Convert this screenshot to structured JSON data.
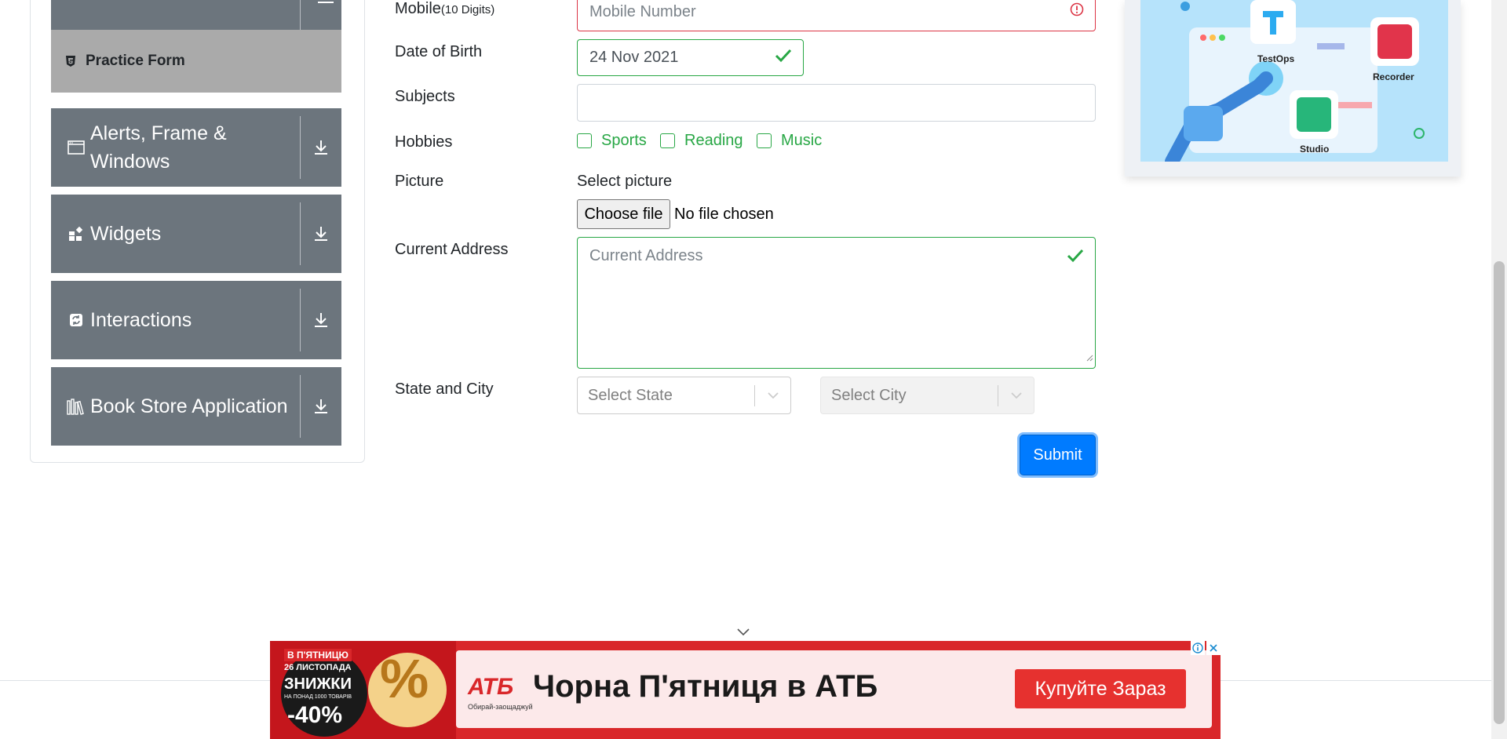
{
  "sidebar": {
    "active_item": {
      "label": "Practice Form",
      "icon": "html5-icon"
    },
    "groups": [
      {
        "label": "Alerts, Frame & Windows",
        "icon": "window-icon"
      },
      {
        "label": "Widgets",
        "icon": "widgets-icon"
      },
      {
        "label": "Interactions",
        "icon": "interactions-icon"
      },
      {
        "label": "Book Store Application",
        "icon": "books-icon"
      }
    ]
  },
  "form": {
    "mobile": {
      "label": "Mobile",
      "label_hint": "(10 Digits)",
      "placeholder": "Mobile Number",
      "status": "invalid"
    },
    "dob": {
      "label": "Date of Birth",
      "value": "24 Nov 2021",
      "status": "valid"
    },
    "subjects": {
      "label": "Subjects",
      "value": ""
    },
    "hobbies": {
      "label": "Hobbies",
      "options": [
        {
          "label": "Sports",
          "checked": false
        },
        {
          "label": "Reading",
          "checked": false
        },
        {
          "label": "Music",
          "checked": false
        }
      ]
    },
    "picture": {
      "label": "Picture",
      "select_label": "Select picture",
      "button_label": "Choose file",
      "file_text": "No file chosen"
    },
    "address": {
      "label": "Current Address",
      "placeholder": "Current Address",
      "status": "valid"
    },
    "state_city": {
      "label": "State and City",
      "state_placeholder": "Select State",
      "city_placeholder": "Select City"
    },
    "submit_label": "Submit"
  },
  "promo": {
    "labels": [
      "TestOps",
      "Recorder",
      "Studio"
    ]
  },
  "ad": {
    "left_line1": "В П'ЯТНИЦЮ",
    "left_line2": "26 ЛИСТОПАДА",
    "left_line3": "ЗНИЖКИ",
    "left_line4": "НА ПОНАД 1000 ТОВАРІВ",
    "left_line5": "-40%",
    "brand": "АТБ",
    "brand_sub": "Обирай-заощаджуй",
    "headline": "Чорна П'ятниця в АТБ",
    "cta": "Купуйте Зараз"
  },
  "colors": {
    "valid": "#28a745",
    "invalid": "#dc3545",
    "primary": "#007bff",
    "sidebar_group": "#6c757d",
    "sidebar_active": "#aaaaaa",
    "ad_red": "#d9272a"
  }
}
